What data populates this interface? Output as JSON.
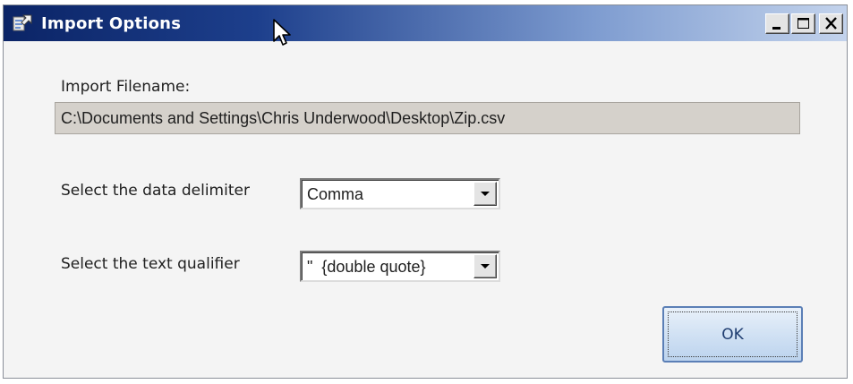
{
  "window": {
    "title": "Import Options",
    "icons": {
      "app": "import-app-icon",
      "minimize": "minimize-icon",
      "maximize": "maximize-icon",
      "close": "close-icon"
    }
  },
  "filename": {
    "label": "Import Filename:",
    "value": "C:\\Documents and Settings\\Chris Underwood\\Desktop\\Zip.csv"
  },
  "delimiter": {
    "label": "Select the data delimiter",
    "selected": "Comma"
  },
  "qualifier": {
    "label": "Select the text qualifier",
    "selected": "\"  {double quote}"
  },
  "buttons": {
    "ok_label": "OK"
  }
}
